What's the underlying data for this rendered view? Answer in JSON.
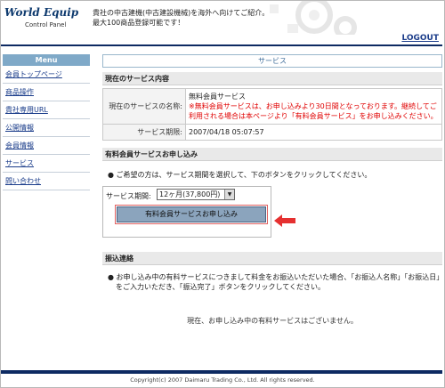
{
  "header": {
    "logo_title": "World Equip",
    "logo_sub": "Control Panel",
    "tagline_line1": "貴社の中古建機(中古建設機械)を海外へ向けてご紹介。",
    "tagline_line2": "最大100商品登録可能です！",
    "logout_label": "LOGOUT"
  },
  "sidebar": {
    "heading": "Menu",
    "items": [
      {
        "label": "会員トップページ"
      },
      {
        "label": "商品操作"
      },
      {
        "label": "貴社専用URL"
      },
      {
        "label": "公開情報"
      },
      {
        "label": "会員情報"
      },
      {
        "label": "サービス"
      },
      {
        "label": "問い合わせ"
      }
    ]
  },
  "main": {
    "page_title": "サービス",
    "current": {
      "heading": "現在のサービス内容",
      "name_label": "現在のサービスの名称:",
      "name_value": "無料会員サービス",
      "name_warning": "※無料会員サービスは、お申し込みより30日間となっております。継続してご利用される場合は本ページより「有料会員サービス」をお申し込みください。",
      "period_label": "サービス期限:",
      "period_value": "2007/04/18 05:07:57"
    },
    "paid": {
      "heading": "有料会員サービスお申し込み",
      "note": "ご希望の方は、サービス期間を選択して、下のボタンをクリックしてください。",
      "period_label": "サービス期間:",
      "period_selected": "12ヶ月(37,800円)",
      "apply_button": "有料会員サービスお申し込み"
    },
    "transfer": {
      "heading": "振込連絡",
      "note_line1": "お申し込み中の有料サービスにつきまして料金をお振込いただいた場合、「お振込人名称」「お振込日」",
      "note_line2": "をご入力いただき、「振込完了」ボタンをクリックしてください。",
      "empty_message": "現在、お申し込み中の有料サービスはございません。"
    }
  },
  "footer": {
    "copyright": "Copyright(c) 2007 Daimaru Trading Co., Ltd. All rights reserved."
  },
  "colors": {
    "navy": "#0d2a62",
    "menu_head": "#7fa9c8",
    "link": "#1a3c8a",
    "warning": "#e00000",
    "button": "#8ba4bd",
    "arrow": "#e53030"
  }
}
